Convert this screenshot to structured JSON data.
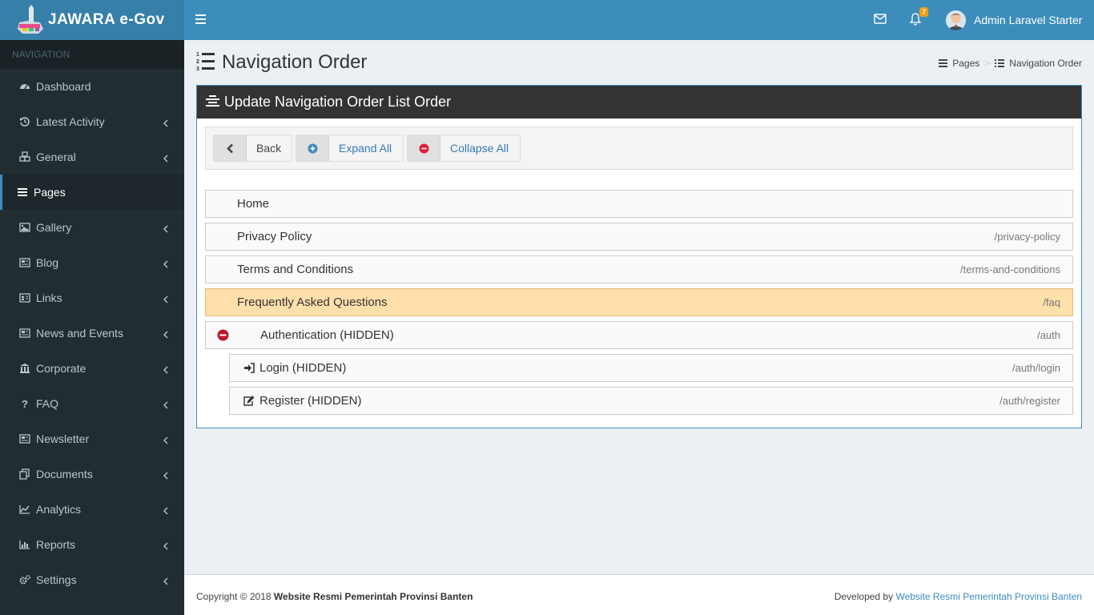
{
  "brand": {
    "name": "JAWARA e-Gov",
    "logo_text": "JAWARA",
    "colors": {
      "header": "#3c8dbc",
      "sidebar": "#222d32",
      "accent": "#3c8dbc",
      "highlight_row": "#ffdfaa",
      "collapse_red": "#dd4b39"
    }
  },
  "sidebar": {
    "header": "NAVIGATION",
    "items": [
      {
        "label": "Dashboard",
        "icon": "dashboard-icon",
        "has_submenu": false,
        "active": false
      },
      {
        "label": "Latest Activity",
        "icon": "history-icon",
        "has_submenu": true,
        "active": false
      },
      {
        "label": "General",
        "icon": "cubes-icon",
        "has_submenu": true,
        "active": false
      },
      {
        "label": "Pages",
        "icon": "bars-icon",
        "has_submenu": false,
        "active": true
      },
      {
        "label": "Gallery",
        "icon": "image-icon",
        "has_submenu": true,
        "active": false
      },
      {
        "label": "Blog",
        "icon": "newspaper-icon",
        "has_submenu": true,
        "active": false
      },
      {
        "label": "Links",
        "icon": "address-card-icon",
        "has_submenu": true,
        "active": false
      },
      {
        "label": "News and Events",
        "icon": "newspaper-icon",
        "has_submenu": true,
        "active": false
      },
      {
        "label": "Corporate",
        "icon": "bank-icon",
        "has_submenu": true,
        "active": false
      },
      {
        "label": "FAQ",
        "icon": "question-icon",
        "has_submenu": true,
        "active": false
      },
      {
        "label": "Newsletter",
        "icon": "newspaper-icon",
        "has_submenu": true,
        "active": false
      },
      {
        "label": "Documents",
        "icon": "copy-icon",
        "has_submenu": true,
        "active": false
      },
      {
        "label": "Analytics",
        "icon": "line-chart-icon",
        "has_submenu": true,
        "active": false
      },
      {
        "label": "Reports",
        "icon": "bar-chart-icon",
        "has_submenu": true,
        "active": false
      },
      {
        "label": "Settings",
        "icon": "cogs-icon",
        "has_submenu": true,
        "active": false
      }
    ]
  },
  "topbar": {
    "notification_count": "7",
    "user_name": "Admin Laravel Starter"
  },
  "page": {
    "title": "Navigation Order",
    "breadcrumb": [
      "Pages",
      "Navigation Order"
    ]
  },
  "box": {
    "title": "Update Navigation Order List Order",
    "buttons": {
      "back": "Back",
      "expand_all": "Expand All",
      "collapse_all": "Collapse All"
    },
    "rows": [
      {
        "title": "Home",
        "slug": ""
      },
      {
        "title": "Privacy Policy",
        "slug": "/privacy-policy"
      },
      {
        "title": "Terms and Conditions",
        "slug": "/terms-and-conditions"
      },
      {
        "title": "Frequently Asked Questions",
        "slug": "/faq",
        "highlighted": true
      },
      {
        "title": "Authentication (HIDDEN)",
        "slug": "/auth",
        "expanded": true
      },
      {
        "title": "Login (HIDDEN)",
        "slug": "/auth/login",
        "icon": "sign-in-icon",
        "child": true
      },
      {
        "title": "Register (HIDDEN)",
        "slug": "/auth/register",
        "icon": "edit-icon",
        "child": true
      }
    ]
  },
  "footer": {
    "copyright_prefix": "Copyright © 2018",
    "copyright_owner": "Website Resmi Pemerintah Provinsi Banten",
    "developed_prefix": "Developed by",
    "developed_link": "Website Resmi Pemerintah Provinsi Banten"
  }
}
